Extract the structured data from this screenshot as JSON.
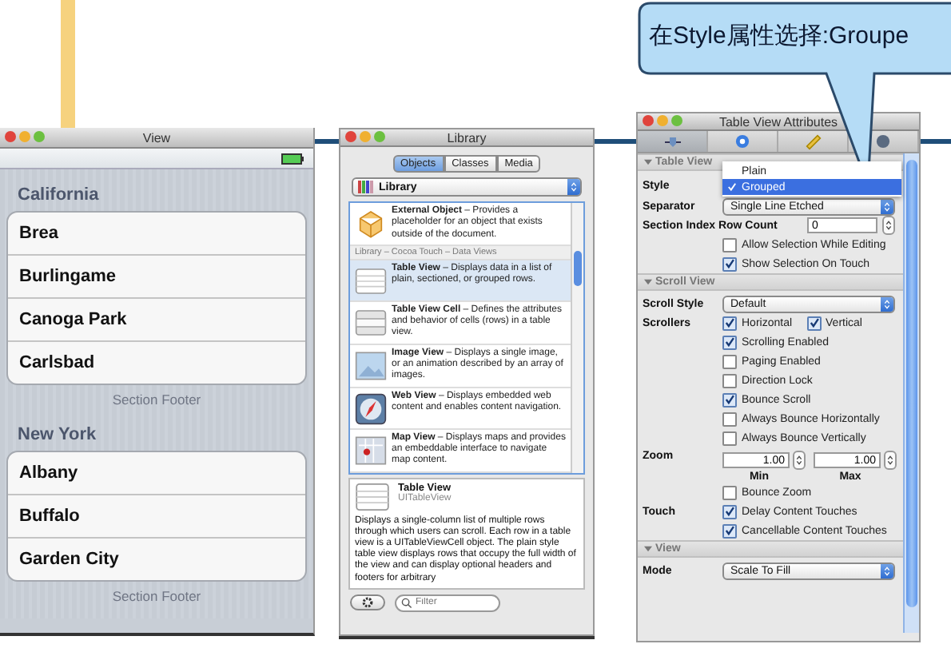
{
  "callout": {
    "text": "在Style属性选择:Groupe"
  },
  "view_window": {
    "title": "View",
    "sections": [
      {
        "header": "California",
        "rows": [
          "Brea",
          "Burlingame",
          "Canoga Park",
          "Carlsbad"
        ],
        "footer": "Section Footer"
      },
      {
        "header": "New York",
        "rows": [
          "Albany",
          "Buffalo",
          "Garden City"
        ],
        "footer": "Section Footer"
      }
    ]
  },
  "library_window": {
    "title": "Library",
    "tabs": [
      {
        "label": "Objects",
        "selected": true
      },
      {
        "label": "Classes",
        "selected": false
      },
      {
        "label": "Media",
        "selected": false
      }
    ],
    "source": "Library",
    "items": [
      {
        "kind": "item",
        "text": "**External Object** – Provides a placeholder for an object that exists outside of the document.",
        "selected": false
      },
      {
        "kind": "group",
        "text": "Library – Cocoa Touch – Data Views"
      },
      {
        "kind": "item",
        "text": "**Table View** – Displays data in a list of plain, sectioned, or grouped rows.",
        "selected": true
      },
      {
        "kind": "item",
        "text": "**Table View Cell** – Defines the attributes and behavior of cells (rows) in a table view.",
        "selected": false
      },
      {
        "kind": "item",
        "text": "**Image View** – Displays a single image, or an animation described by an array of images.",
        "selected": false
      },
      {
        "kind": "item",
        "text": "**Web View** – Displays embedded web content and enables content navigation.",
        "selected": false
      },
      {
        "kind": "item",
        "text": "**Map View** – Displays maps and provides an embeddable interface to navigate map content.",
        "selected": false
      }
    ],
    "detail": {
      "title": "Table View",
      "subtitle": "UITableView",
      "description": "Displays a single-column list of multiple rows through which users can scroll. Each row in a table view is a UITableViewCell object. The plain style table view displays rows that occupy the full width of the view and can display optional headers and footers for arbitrary"
    },
    "filter": {
      "placeholder": "Filter"
    }
  },
  "attributes_window": {
    "title": "Table View Attributes",
    "sections": [
      {
        "title": "Table View",
        "rows": [
          {
            "kind": "menu",
            "label": "Style",
            "options": [
              {
                "label": "Plain",
                "selected": false
              },
              {
                "label": "Grouped",
                "selected": true
              }
            ]
          },
          {
            "kind": "popup",
            "label": "Separator",
            "value": "Single Line Etched"
          },
          {
            "kind": "number",
            "label": "Section Index Row Count",
            "value": "0"
          },
          {
            "kind": "checks",
            "checks": [
              {
                "label": "Allow Selection While Editing",
                "checked": false
              }
            ]
          },
          {
            "kind": "checks",
            "checks": [
              {
                "label": "Show Selection On Touch",
                "checked": true
              }
            ]
          }
        ]
      },
      {
        "title": "Scroll View",
        "rows": [
          {
            "kind": "popup",
            "label": "Scroll Style",
            "value": "Default"
          },
          {
            "kind": "checks",
            "label": "Scrollers",
            "checks": [
              {
                "label": "Horizontal",
                "checked": true
              },
              {
                "label": "Vertical",
                "checked": true
              }
            ]
          },
          {
            "kind": "checks",
            "checks": [
              {
                "label": "Scrolling Enabled",
                "checked": true
              }
            ]
          },
          {
            "kind": "checks",
            "checks": [
              {
                "label": "Paging Enabled",
                "checked": false
              }
            ]
          },
          {
            "kind": "checks",
            "checks": [
              {
                "label": "Direction Lock",
                "checked": false
              }
            ]
          },
          {
            "kind": "checks",
            "checks": [
              {
                "label": "Bounce Scroll",
                "checked": true
              }
            ]
          },
          {
            "kind": "checks",
            "checks": [
              {
                "label": "Always Bounce Horizontally",
                "checked": false
              }
            ]
          },
          {
            "kind": "checks",
            "checks": [
              {
                "label": "Always Bounce Vertically",
                "checked": false
              }
            ]
          },
          {
            "kind": "zoom",
            "label": "Zoom",
            "fields": [
              {
                "value": "1.00",
                "caption": "Min"
              },
              {
                "value": "1.00",
                "caption": "Max"
              }
            ]
          },
          {
            "kind": "checks",
            "checks": [
              {
                "label": "Bounce Zoom",
                "checked": false
              }
            ]
          },
          {
            "kind": "checks",
            "label": "Touch",
            "checks": [
              {
                "label": "Delay Content Touches",
                "checked": true
              }
            ]
          },
          {
            "kind": "checks",
            "checks": [
              {
                "label": "Cancellable Content Touches",
                "checked": true
              }
            ]
          }
        ]
      },
      {
        "title": "View",
        "rows": [
          {
            "kind": "popup",
            "label": "Mode",
            "value": "Scale To Fill"
          }
        ]
      }
    ]
  }
}
